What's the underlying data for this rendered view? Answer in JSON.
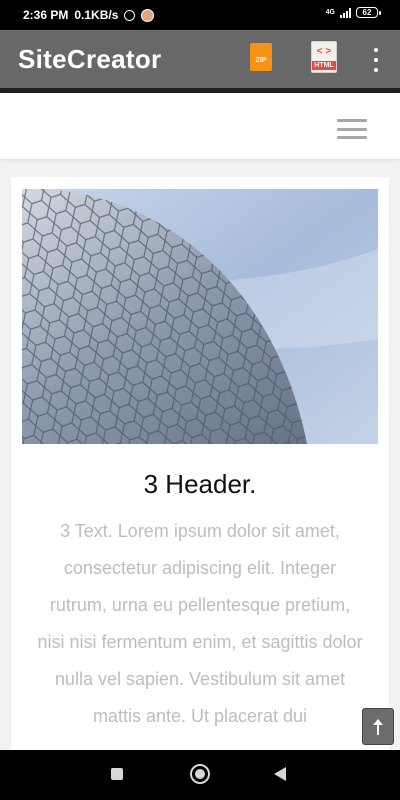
{
  "status_bar": {
    "time": "2:36 PM",
    "network_speed": "0.1KB/s",
    "network_type": "4G",
    "battery": "62",
    "icons": [
      "alarm-icon",
      "app-notification-icon",
      "signal-icon",
      "battery-icon"
    ]
  },
  "app_bar": {
    "title": "SiteCreator",
    "zip_icon_label": "ZIP",
    "html_icon_code": "< >",
    "html_icon_label": "HTML",
    "background_color": "#686868"
  },
  "site": {
    "menu_icon": "hamburger-menu-icon"
  },
  "card": {
    "image_alt": "architecture-dome-image",
    "header": "3 Header.",
    "text": "3 Text. Lorem ipsum dolor sit amet, consectetur adipiscing elit. Integer rutrum, urna eu pellentesque pretium, nisi nisi fermentum enim, et sagittis dolor nulla vel sapien. Vestibulum sit amet mattis ante. Ut placerat dui"
  },
  "scroll_top": {
    "icon": "arrow-up-icon"
  },
  "nav_bar": {
    "icons": [
      "recent-apps-icon",
      "home-icon",
      "back-icon"
    ]
  }
}
